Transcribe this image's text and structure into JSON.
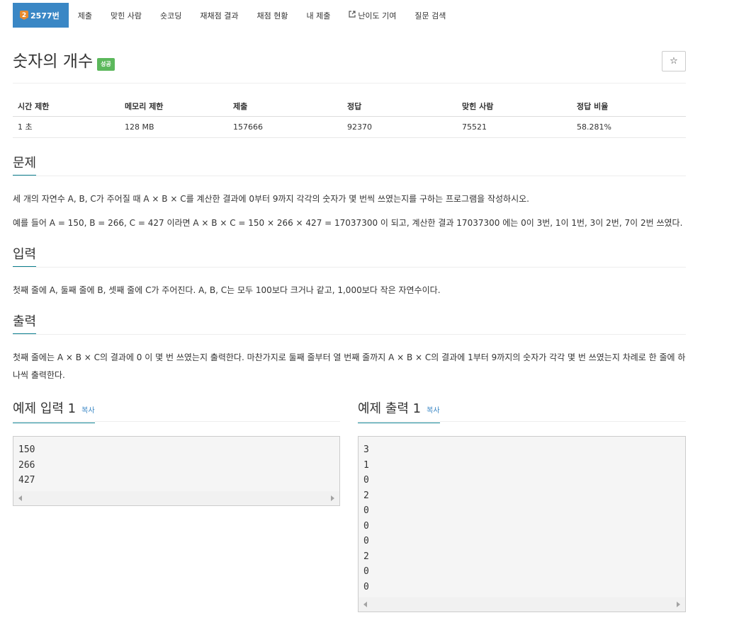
{
  "nav": {
    "tabs": [
      {
        "label": "2577번",
        "tier": "2"
      },
      {
        "label": "제출"
      },
      {
        "label": "맞힌 사람"
      },
      {
        "label": "숏코딩"
      },
      {
        "label": "재채점 결과"
      },
      {
        "label": "채점 현황"
      },
      {
        "label": "내 제출"
      },
      {
        "label": "난이도 기여"
      },
      {
        "label": "질문 검색"
      }
    ]
  },
  "problem": {
    "title": "숫자의 개수",
    "badge": "성공",
    "star_icon": "☆"
  },
  "info": {
    "headers": [
      "시간 제한",
      "메모리 제한",
      "제출",
      "정답",
      "맞힌 사람",
      "정답 비율"
    ],
    "values": [
      "1 초",
      "128 MB",
      "157666",
      "92370",
      "75521",
      "58.281%"
    ]
  },
  "sections": {
    "problem_head": "문제",
    "problem_p1": "세 개의 자연수 A, B, C가 주어질 때 A × B × C를 계산한 결과에 0부터 9까지 각각의 숫자가 몇 번씩 쓰였는지를 구하는 프로그램을 작성하시오.",
    "problem_p2": "예를 들어 A = 150, B = 266, C = 427 이라면 A × B × C = 150 × 266 × 427 = 17037300 이 되고, 계산한 결과 17037300 에는 0이 3번, 1이 1번, 3이 2번, 7이 2번 쓰였다.",
    "input_head": "입력",
    "input_p": "첫째 줄에 A, 둘째 줄에 B, 셋째 줄에 C가 주어진다. A, B, C는 모두 100보다 크거나 같고, 1,000보다 작은 자연수이다.",
    "output_head": "출력",
    "output_p": "첫째 줄에는 A × B × C의 결과에 0 이 몇 번 쓰였는지 출력한다. 마찬가지로 둘째 줄부터 열 번째 줄까지 A × B × C의 결과에 1부터 9까지의 숫자가 각각 몇 번 쓰였는지 차례로 한 줄에 하나씩 출력한다."
  },
  "samples": {
    "input_head": "예제 입력 1",
    "output_head": "예제 출력 1",
    "copy_label": "복사",
    "input_lines": [
      "150",
      "266",
      "427"
    ],
    "output_lines": [
      "3",
      "1",
      "0",
      "2",
      "0",
      "0",
      "0",
      "2",
      "0",
      "0"
    ]
  }
}
